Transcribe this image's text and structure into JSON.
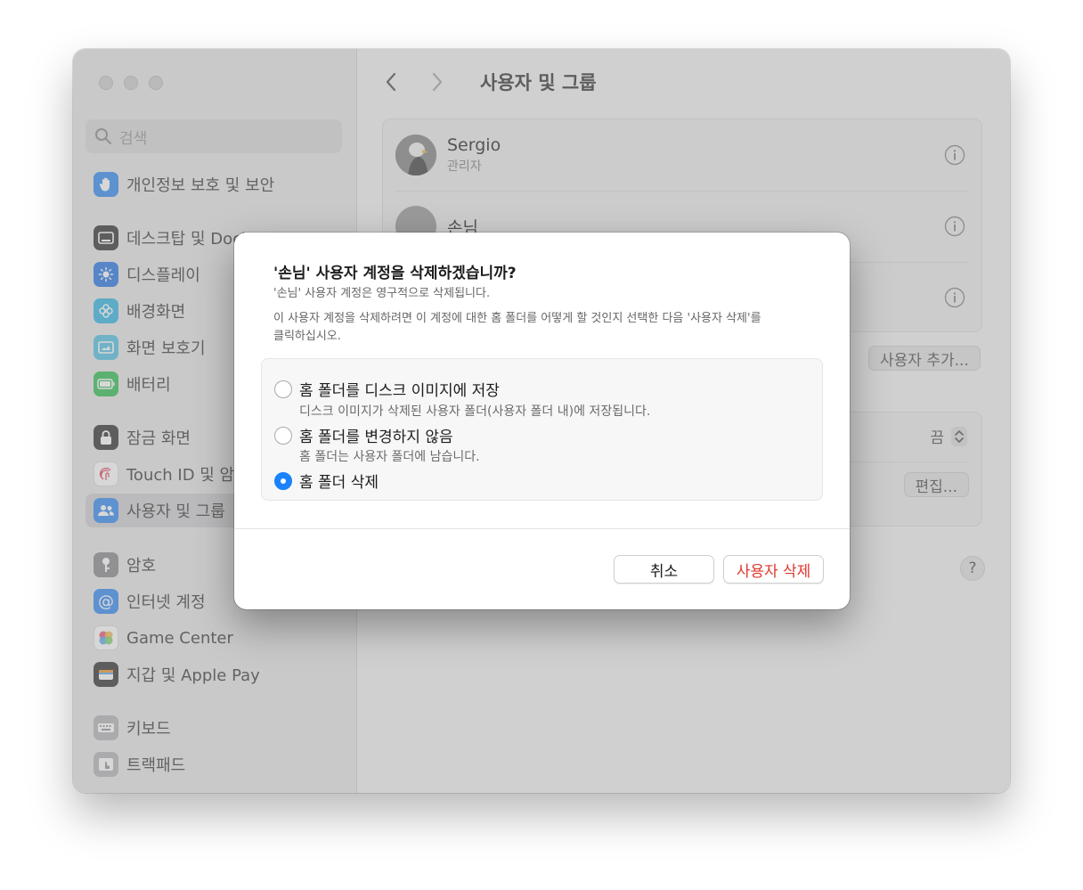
{
  "search": {
    "placeholder": "검색"
  },
  "sidebar": {
    "items": [
      {
        "label": "개인정보 보호 및 보안",
        "icon": "hand-icon",
        "color": "#3d8ff2"
      },
      {
        "label": "데스크탑 및 Dock",
        "icon": "desktop-dock-icon",
        "color": "#3a3a3c"
      },
      {
        "label": "디스플레이",
        "icon": "sun-icon",
        "color": "#2f7de6"
      },
      {
        "label": "배경화면",
        "icon": "flower-icon",
        "color": "#3ab8e6"
      },
      {
        "label": "화면 보호기",
        "icon": "screensaver-icon",
        "color": "#5ac4e6"
      },
      {
        "label": "배터리",
        "icon": "battery-icon",
        "color": "#39c25a"
      },
      {
        "label": "잠금 화면",
        "icon": "lock-icon",
        "color": "#3a3a3c"
      },
      {
        "label": "Touch ID 및 암호",
        "icon": "fingerprint-icon",
        "color": "#ffffff"
      },
      {
        "label": "사용자 및 그룹",
        "icon": "users-icon",
        "color": "#3d8ff2"
      },
      {
        "label": "암호",
        "icon": "key-icon",
        "color": "#8e8e93"
      },
      {
        "label": "인터넷 계정",
        "icon": "at-icon",
        "color": "#3d8ff2"
      },
      {
        "label": "Game Center",
        "icon": "game-center-icon",
        "color": "#ffffff"
      },
      {
        "label": "지갑 및 Apple Pay",
        "icon": "wallet-icon",
        "color": "#3a3a3c"
      },
      {
        "label": "키보드",
        "icon": "keyboard-icon",
        "color": "#b9b9bd"
      },
      {
        "label": "트랙패드",
        "icon": "trackpad-icon",
        "color": "#b9b9bd"
      }
    ]
  },
  "header": {
    "title": "사용자 및 그룹"
  },
  "users": [
    {
      "name": "Sergio",
      "role": "관리자"
    },
    {
      "name": "손님",
      "role": ""
    }
  ],
  "content": {
    "add_user_label": "사용자 추가...",
    "setting_value": "끔",
    "edit_label": "편집...",
    "help_label": "?"
  },
  "dialog": {
    "title": "'손님' 사용자 계정을 삭제하겠습니까?",
    "subtitle": "'손님' 사용자 계정은 영구적으로 삭제됩니다.",
    "description": "이 사용자 계정을 삭제하려면 이 계정에 대한 홈 폴더를 어떻게 할 것인지 선택한 다음 '사용자 삭제'를 클릭하십시오.",
    "options": [
      {
        "label": "홈 폴더를 디스크 이미지에 저장",
        "desc": "디스크 이미지가 삭제된 사용자 폴더(사용자 폴더 내)에 저장됩니다.",
        "selected": false
      },
      {
        "label": "홈 폴더를 변경하지 않음",
        "desc": "홈 폴더는 사용자 폴더에 남습니다.",
        "selected": false
      },
      {
        "label": "홈 폴더 삭제",
        "desc": "",
        "selected": true
      }
    ],
    "cancel_label": "취소",
    "delete_label": "사용자 삭제"
  },
  "colors": {
    "accent": "#1a82fb",
    "destructive": "#e0382f"
  }
}
